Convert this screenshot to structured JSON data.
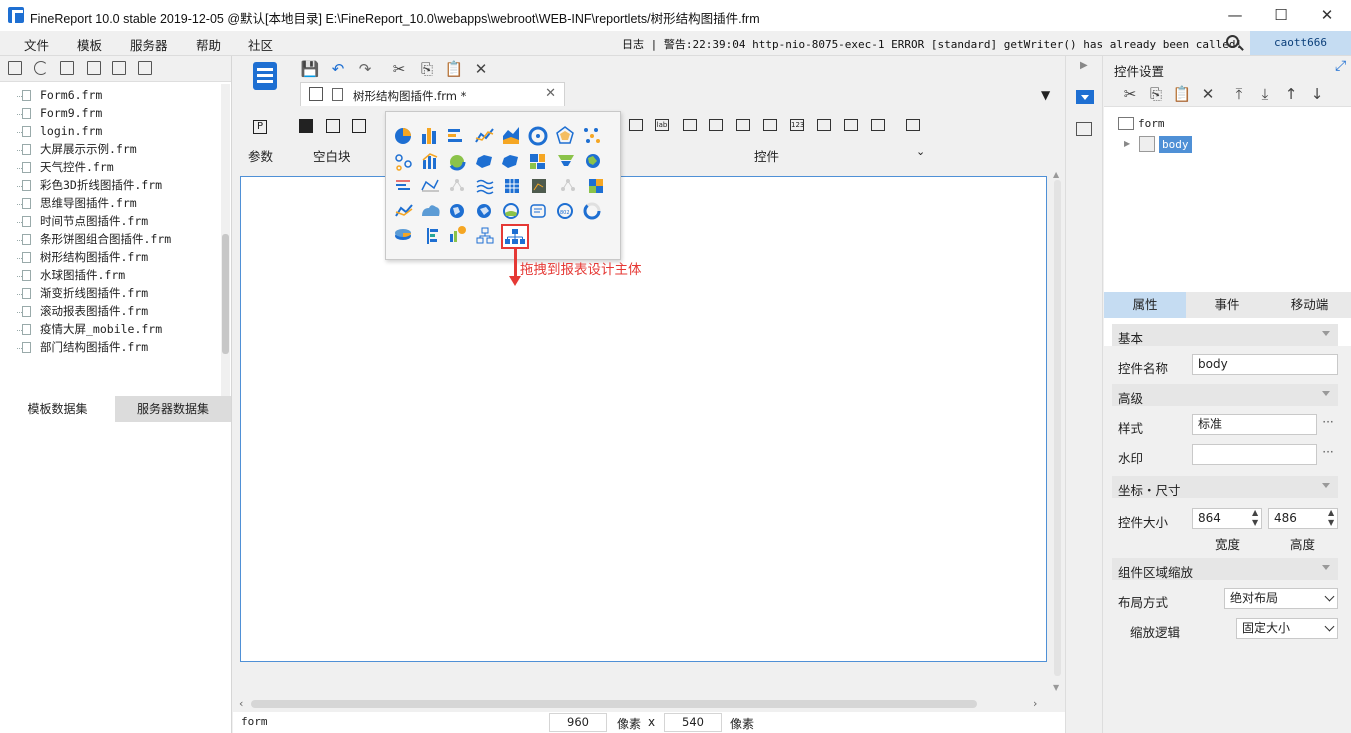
{
  "app": {
    "window_title": "FineReport 10.0 stable 2019-12-05 @默认[本地目录]     E:\\FineReport_10.0\\webapps\\webroot\\WEB-INF\\reportlets/树形结构图插件.frm",
    "minimize": "—",
    "maximize": "☐",
    "close": "✕"
  },
  "menubar": {
    "items": [
      "文件",
      "模板",
      "服务器",
      "帮助",
      "社区"
    ],
    "log": "日志 | 警告:22:39:04 http-nio-8075-exec-1 ERROR [standard] getWriter() has already been called!",
    "user": "caott666"
  },
  "files": [
    "Form6.frm",
    "Form9.frm",
    "login.frm",
    "大屏展示示例.frm",
    "天气控件.frm",
    "彩色3D折线图插件.frm",
    "思维导图插件.frm",
    "时间节点图插件.frm",
    "条形饼图组合图插件.frm",
    "树形结构图插件.frm",
    "水球图插件.frm",
    "渐变折线图插件.frm",
    "滚动报表图插件.frm",
    "疫情大屏_mobile.frm",
    "部门结构图插件.frm"
  ],
  "datasets": {
    "tabs": [
      "模板数据集",
      "服务器数据集"
    ]
  },
  "editor": {
    "tab_title": "树形结构图插件.frm *",
    "tab_close": "✕",
    "group_labels": {
      "params": "参数",
      "blank_block": "空白块",
      "controls": "控件"
    },
    "width": "960",
    "height": "540",
    "unit": "像素",
    "times": "x",
    "status_left": "form"
  },
  "annotation": "拖拽到报表设计主体",
  "right": {
    "header": "控件设置",
    "tree": {
      "root": "form",
      "child": "body"
    },
    "tabs": [
      "属性",
      "事件",
      "移动端"
    ],
    "sections": {
      "basic": "基本",
      "advanced": "高级",
      "position_size": "坐标・尺寸",
      "zoom": "组件区域缩放"
    },
    "fields": {
      "widget_name_label": "控件名称",
      "widget_name": "body",
      "style_label": "样式",
      "style": "标准",
      "watermark_label": "水印",
      "watermark": "",
      "size_label": "控件大小",
      "width": "864",
      "height": "486",
      "width_label": "宽度",
      "height_label": "高度",
      "layout_label": "布局方式",
      "layout": "绝对布局",
      "scale_label": "缩放逻辑",
      "scale": "固定大小",
      "more": "···"
    }
  },
  "colors": {
    "accent": "#1e6fd2",
    "highlight": "#e53935",
    "selection": "#4f90d6"
  }
}
